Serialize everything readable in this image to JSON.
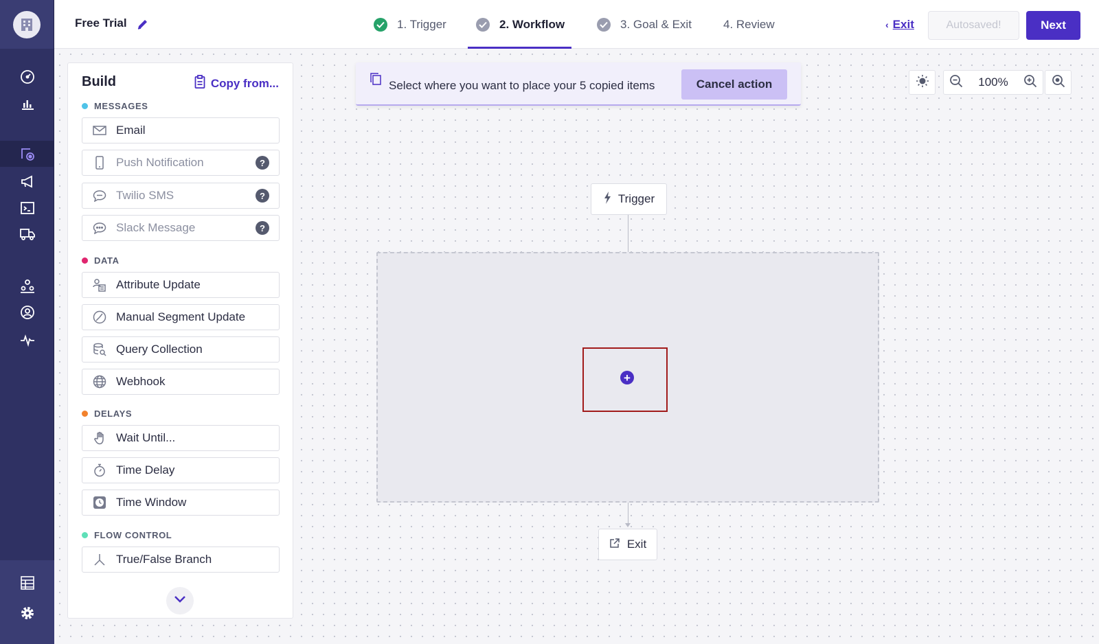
{
  "sidebar": {
    "icons": [
      "building-icon",
      "dashboard-icon",
      "chart-icon",
      "journeys-icon",
      "megaphone-icon",
      "terminal-icon",
      "delivery-icon",
      "users-icon",
      "user-circle-icon",
      "pulse-icon",
      "table-icon",
      "gear-icon"
    ]
  },
  "header": {
    "title": "Free Trial",
    "steps": [
      {
        "label": "1. Trigger",
        "state": "complete"
      },
      {
        "label": "2. Workflow",
        "state": "active"
      },
      {
        "label": "3. Goal & Exit",
        "state": "complete"
      },
      {
        "label": "4. Review",
        "state": "pending"
      }
    ],
    "exit_label": "Exit",
    "autosaved_label": "Autosaved!",
    "next_label": "Next"
  },
  "build": {
    "title": "Build",
    "copy_from": "Copy from...",
    "sections": [
      {
        "label": "MESSAGES",
        "color": "#4fc3e8",
        "items": [
          "Email",
          "Push Notification",
          "Twilio SMS",
          "Slack Message"
        ]
      },
      {
        "label": "DATA",
        "color": "#e0266f",
        "items": [
          "Attribute Update",
          "Manual Segment Update",
          "Query Collection",
          "Webhook"
        ]
      },
      {
        "label": "DELAYS",
        "color": "#f2822c",
        "items": [
          "Wait Until...",
          "Time Delay",
          "Time Window"
        ]
      },
      {
        "label": "FLOW CONTROL",
        "color": "#5fe0b8",
        "items": [
          "True/False Branch"
        ]
      }
    ],
    "help_glyph": "?"
  },
  "toast": {
    "message": "Select where you want to place your 5 copied items",
    "cancel_label": "Cancel action"
  },
  "zoom": {
    "level": "100%"
  },
  "flow": {
    "trigger_label": "Trigger",
    "exit_label": "Exit",
    "plus_glyph": "+"
  },
  "colors": {
    "accent": "#4a2fc4",
    "rail": "#2f3163"
  }
}
